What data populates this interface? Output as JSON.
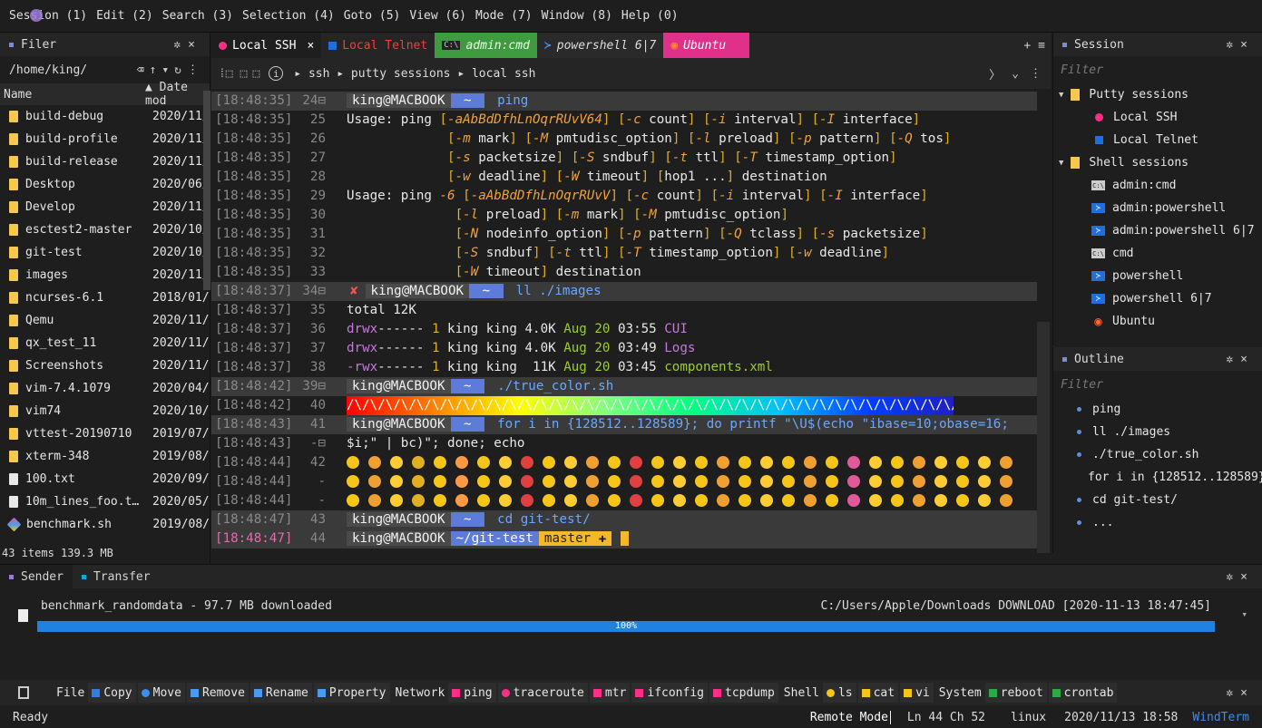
{
  "menubar": {
    "items": [
      "Session (1)",
      "Edit (2)",
      "Search (3)",
      "Selection (4)",
      "Goto (5)",
      "View (6)",
      "Mode (7)",
      "Window (8)",
      "Help (0)"
    ]
  },
  "filer": {
    "title": "Filer",
    "path": "/home/king/",
    "col_name": "Name",
    "col_date": "Date mod",
    "files": [
      {
        "name": "build-debug",
        "date": "2020/11/",
        "type": "folder"
      },
      {
        "name": "build-profile",
        "date": "2020/11/",
        "type": "folder"
      },
      {
        "name": "build-release",
        "date": "2020/11/",
        "type": "folder"
      },
      {
        "name": "Desktop",
        "date": "2020/06/",
        "type": "folder"
      },
      {
        "name": "Develop",
        "date": "2020/11/",
        "type": "folder"
      },
      {
        "name": "esctest2-master",
        "date": "2020/10/",
        "type": "folder"
      },
      {
        "name": "git-test",
        "date": "2020/10/",
        "type": "folder"
      },
      {
        "name": "images",
        "date": "2020/11/",
        "type": "folder"
      },
      {
        "name": "ncurses-6.1",
        "date": "2018/01/",
        "type": "folder"
      },
      {
        "name": "Qemu",
        "date": "2020/11/",
        "type": "folder"
      },
      {
        "name": "qx_test_11",
        "date": "2020/11/",
        "type": "folder"
      },
      {
        "name": "Screenshots",
        "date": "2020/11/",
        "type": "folder"
      },
      {
        "name": "vim-7.4.1079",
        "date": "2020/04/",
        "type": "folder"
      },
      {
        "name": "vim74",
        "date": "2020/10/",
        "type": "folder"
      },
      {
        "name": "vttest-20190710",
        "date": "2019/07/",
        "type": "folder"
      },
      {
        "name": "xterm-348",
        "date": "2019/08/",
        "type": "folder"
      },
      {
        "name": "100.txt",
        "date": "2020/09/",
        "type": "file"
      },
      {
        "name": "10m_lines_foo.t…",
        "date": "2020/05/",
        "type": "file"
      },
      {
        "name": "benchmark.sh",
        "date": "2019/08/",
        "type": "script"
      }
    ],
    "status": "43 items 139.3 MB"
  },
  "tabs": [
    {
      "label": "Local SSH",
      "color": "#ff2e88",
      "active": true
    },
    {
      "label": "Local Telnet",
      "color": "#1e6fe0",
      "active": false
    },
    {
      "label": "admin:cmd",
      "color": "#3f9b3f",
      "active": false
    },
    {
      "label": "powershell 6|7",
      "color": "#2a2a2a",
      "active": false
    },
    {
      "label": "Ubuntu",
      "color": "#e0308a",
      "active": false
    }
  ],
  "breadcrumb": [
    "ssh",
    "putty sessions",
    "local ssh"
  ],
  "terminal": {
    "host": "king@MACBOOK",
    "lines": [
      {
        "ts": "[18:48:35]",
        "ln": "24⊟",
        "prompt": true,
        "cmd": "ping"
      },
      {
        "ts": "[18:48:35]",
        "ln": "25",
        "text": "Usage: ping [-aAbBdDfhLnOqrRUvV64] [-c count] [-i interval] [-I interface]"
      },
      {
        "ts": "[18:48:35]",
        "ln": "26",
        "text": "             [-m mark] [-M pmtudisc_option] [-l preload] [-p pattern] [-Q tos]"
      },
      {
        "ts": "[18:48:35]",
        "ln": "27",
        "text": "             [-s packetsize] [-S sndbuf] [-t ttl] [-T timestamp_option]"
      },
      {
        "ts": "[18:48:35]",
        "ln": "28",
        "text": "             [-w deadline] [-W timeout] [hop1 ...] destination"
      },
      {
        "ts": "[18:48:35]",
        "ln": "29",
        "text": "Usage: ping -6 [-aAbBdDfhLnOqrRUvV] [-c count] [-i interval] [-I interface]"
      },
      {
        "ts": "[18:48:35]",
        "ln": "30",
        "text": "              [-l preload] [-m mark] [-M pmtudisc_option]"
      },
      {
        "ts": "[18:48:35]",
        "ln": "31",
        "text": "              [-N nodeinfo_option] [-p pattern] [-Q tclass] [-s packetsize]"
      },
      {
        "ts": "[18:48:35]",
        "ln": "32",
        "text": "              [-S sndbuf] [-t ttl] [-T timestamp_option] [-w deadline]"
      },
      {
        "ts": "[18:48:35]",
        "ln": "33",
        "text": "              [-W timeout] destination"
      },
      {
        "ts": "[18:48:37]",
        "ln": "34⊟",
        "prompt": true,
        "err": true,
        "cmd": "ll ./images"
      },
      {
        "ts": "[18:48:37]",
        "ln": "35",
        "text": "total 12K"
      },
      {
        "ts": "[18:48:37]",
        "ln": "36",
        "ls": [
          "drwx------",
          "1",
          "king king",
          "4.0K",
          "Aug 20",
          "03:55",
          "CUI"
        ]
      },
      {
        "ts": "[18:48:37]",
        "ln": "37",
        "ls": [
          "drwx------",
          "1",
          "king king",
          "4.0K",
          "Aug 20",
          "03:49",
          "Logs"
        ]
      },
      {
        "ts": "[18:48:37]",
        "ln": "38",
        "ls": [
          "-rwx------",
          "1",
          "king king",
          " 11K",
          "Aug 20",
          "03:45",
          "components.xml"
        ]
      },
      {
        "ts": "[18:48:42]",
        "ln": "39⊟",
        "prompt": true,
        "cmd": "./true_color.sh"
      },
      {
        "ts": "[18:48:42]",
        "ln": "40",
        "rainbow": "/\\/\\/\\/\\/\\/\\/\\/\\/\\/\\/\\/\\/\\/\\/\\/\\/\\/\\/\\/\\/\\/\\/\\/\\/\\/\\/\\/\\/\\/\\/\\/\\/\\/\\/\\/\\/\\/\\/\\/"
      },
      {
        "ts": "[18:48:43]",
        "ln": "41",
        "prompt": true,
        "cmd": "for i in {128512..128589}; do printf \"\\U$(echo \"ibase=10;obase=16;"
      },
      {
        "ts": "[18:48:43]",
        "ln": "-⊟",
        "text": "$i;\" | bc)\"; done; echo"
      },
      {
        "ts": "[18:48:44]",
        "ln": "42",
        "emoji": true
      },
      {
        "ts": "[18:48:44]",
        "ln": "-",
        "emoji": true
      },
      {
        "ts": "[18:48:44]",
        "ln": "-",
        "emoji": true
      },
      {
        "ts": "[18:48:47]",
        "ln": "43",
        "prompt": true,
        "cmd": "cd git-test/"
      },
      {
        "ts": "[18:48:47]",
        "ln": "44",
        "prompt": true,
        "dir": "~/git-test",
        "branch": "master ✚"
      }
    ]
  },
  "session": {
    "title": "Session",
    "filter": "Filter",
    "groups": [
      {
        "label": "Putty sessions",
        "items": [
          {
            "label": "Local SSH",
            "icon": "pink-dot"
          },
          {
            "label": "Local Telnet",
            "icon": "blue-square"
          }
        ]
      },
      {
        "label": "Shell sessions",
        "items": [
          {
            "label": "admin:cmd",
            "icon": "cmd-icon"
          },
          {
            "label": "admin:powershell",
            "icon": "powershell-icon"
          },
          {
            "label": "admin:powershell 6|7",
            "icon": "powershell-icon"
          },
          {
            "label": "cmd",
            "icon": "cmd-icon"
          },
          {
            "label": "powershell",
            "icon": "powershell-icon"
          },
          {
            "label": "powershell 6|7",
            "icon": "powershell-icon"
          },
          {
            "label": "Ubuntu",
            "icon": "ubuntu-icon"
          }
        ]
      }
    ]
  },
  "outline": {
    "title": "Outline",
    "filter": "Filter",
    "items": [
      "ping",
      "ll ./images",
      "./true_color.sh",
      "for i in {128512..128589}",
      "cd git-test/",
      "..."
    ]
  },
  "bottom": {
    "tabs": [
      "Sender",
      "Transfer"
    ],
    "transfer_name": "benchmark_randomdata - 97.7 MB downloaded",
    "transfer_dest": "C:/Users/Apple/Downloads DOWNLOAD [2020-11-13 18:47:45]",
    "progress_label": "100%",
    "progress_value": 100
  },
  "toolbar": {
    "file_label": "File",
    "file_items": [
      {
        "label": "Copy",
        "color": "#2f7fe0"
      },
      {
        "label": "Move",
        "color": "#3a8ef0"
      },
      {
        "label": "Remove",
        "color": "#4a9af0"
      },
      {
        "label": "Rename",
        "color": "#4a9af0"
      },
      {
        "label": "Property",
        "color": "#4a9af0"
      }
    ],
    "network_label": "Network",
    "network_items": [
      {
        "label": "ping",
        "color": "#ff2e88"
      },
      {
        "label": "traceroute",
        "color": "#ff2e88"
      },
      {
        "label": "mtr",
        "color": "#ff2e88"
      },
      {
        "label": "ifconfig",
        "color": "#ff2e88"
      },
      {
        "label": "tcpdump",
        "color": "#ff2e88"
      }
    ],
    "shell_label": "Shell",
    "shell_items": [
      {
        "label": "ls",
        "color": "#f5c518"
      },
      {
        "label": "cat",
        "color": "#f5c518"
      },
      {
        "label": "vi",
        "color": "#f5c518"
      }
    ],
    "system_label": "System",
    "system_items": [
      {
        "label": "reboot",
        "color": "#2eaa44"
      },
      {
        "label": "crontab",
        "color": "#2eaa44"
      }
    ]
  },
  "status": {
    "left": "Ready",
    "mode": "Remote Mode",
    "pos": "Ln 44 Ch 52",
    "os": "linux",
    "time": "2020/11/13 18:58",
    "app": "WindTerm"
  }
}
